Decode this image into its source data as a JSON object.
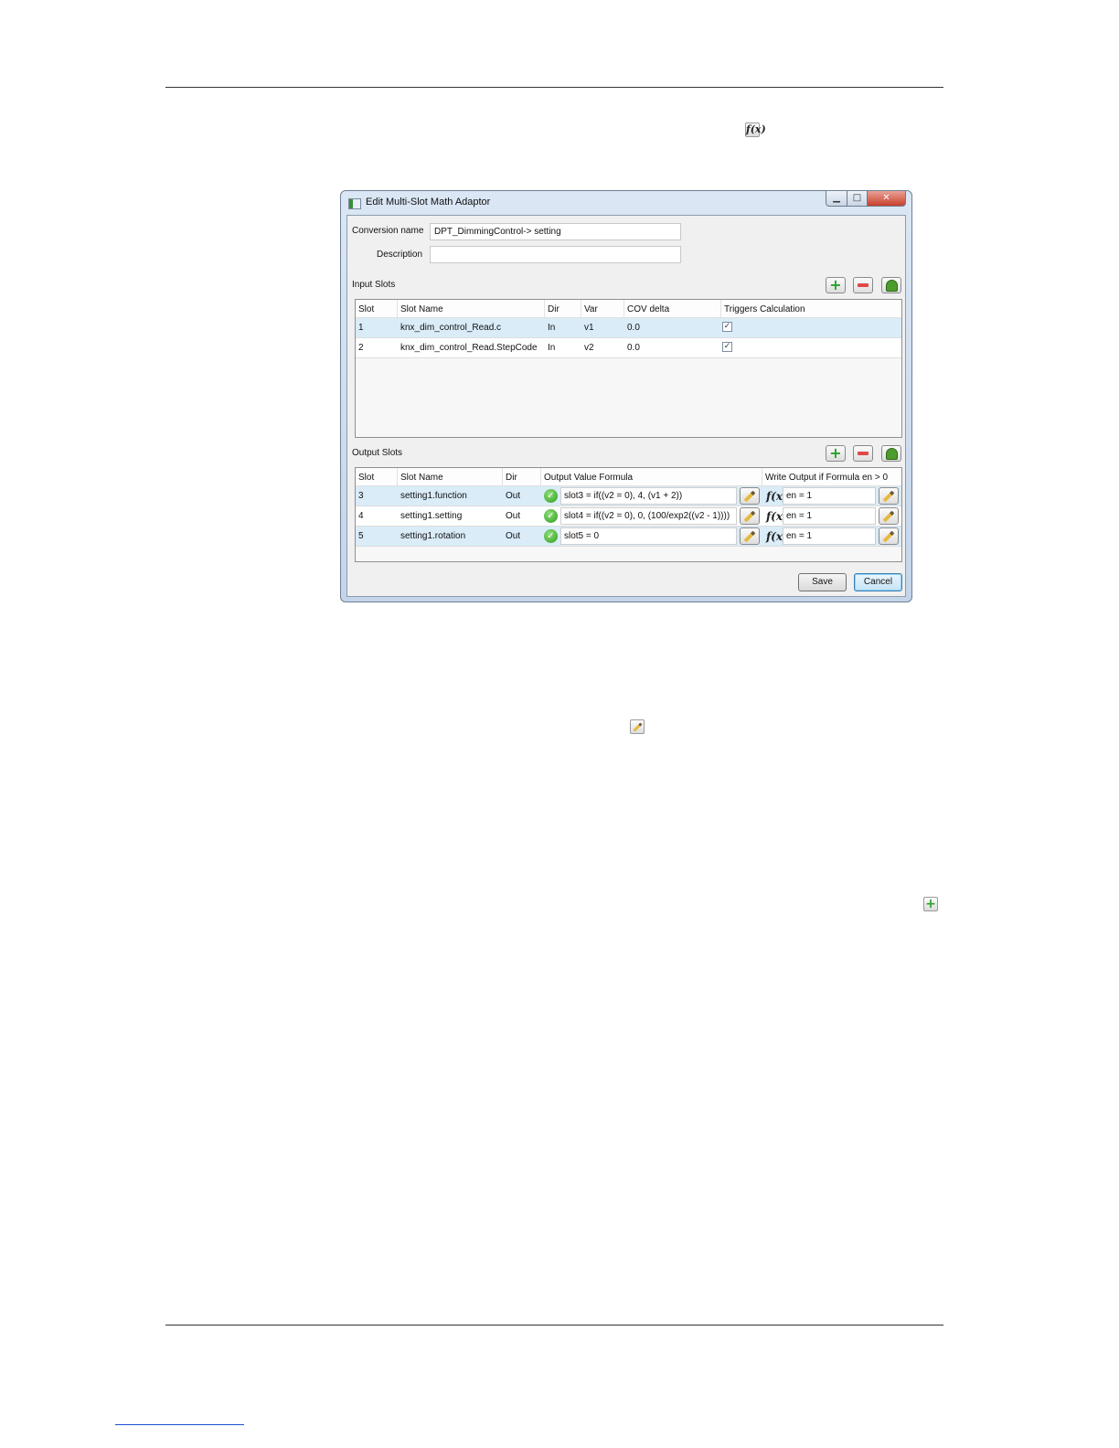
{
  "dialog": {
    "title": "Edit Multi-Slot Math Adaptor",
    "window_buttons": {
      "minimize": "▁",
      "maximize": "□",
      "close": "✕"
    },
    "conversion_name": {
      "label": "Conversion name",
      "value": "DPT_DimmingControl-> setting"
    },
    "description": {
      "label": "Description",
      "value": ""
    },
    "input_slots": {
      "label": "Input Slots",
      "columns": [
        "Slot",
        "Slot Name",
        "Dir",
        "Var",
        "COV delta",
        "Triggers Calculation"
      ],
      "rows": [
        {
          "slot": "1",
          "name": "knx_dim_control_Read.c",
          "dir": "In",
          "var": "v1",
          "cov": "0.0",
          "triggers": "✓"
        },
        {
          "slot": "2",
          "name": "knx_dim_control_Read.StepCode",
          "dir": "In",
          "var": "v2",
          "cov": "0.0",
          "triggers": "✓"
        }
      ]
    },
    "output_slots": {
      "label": "Output Slots",
      "columns": [
        "Slot",
        "Slot Name",
        "Dir",
        "Output Value Formula",
        "Write Output if Formula en > 0"
      ],
      "rows": [
        {
          "slot": "3",
          "name": "setting1.function",
          "dir": "Out",
          "formula": "slot3 = if((v2 = 0), 4, (v1 + 2))",
          "fx": "f(x)",
          "en": "en = 1"
        },
        {
          "slot": "4",
          "name": "setting1.setting",
          "dir": "Out",
          "formula": "slot4 = if((v2 = 0), 0, (100/exp2((v2 - 1))))",
          "fx": "f(x)",
          "en": "en = 1"
        },
        {
          "slot": "5",
          "name": "setting1.rotation",
          "dir": "Out",
          "formula": "slot5 = 0",
          "fx": "f(x)",
          "en": "en = 1"
        }
      ]
    },
    "buttons": {
      "save": "Save",
      "cancel": "Cancel"
    },
    "icons": {
      "add": "+",
      "check": "✓"
    }
  },
  "page_icons": {
    "fx": "f(x)",
    "add": "+"
  }
}
